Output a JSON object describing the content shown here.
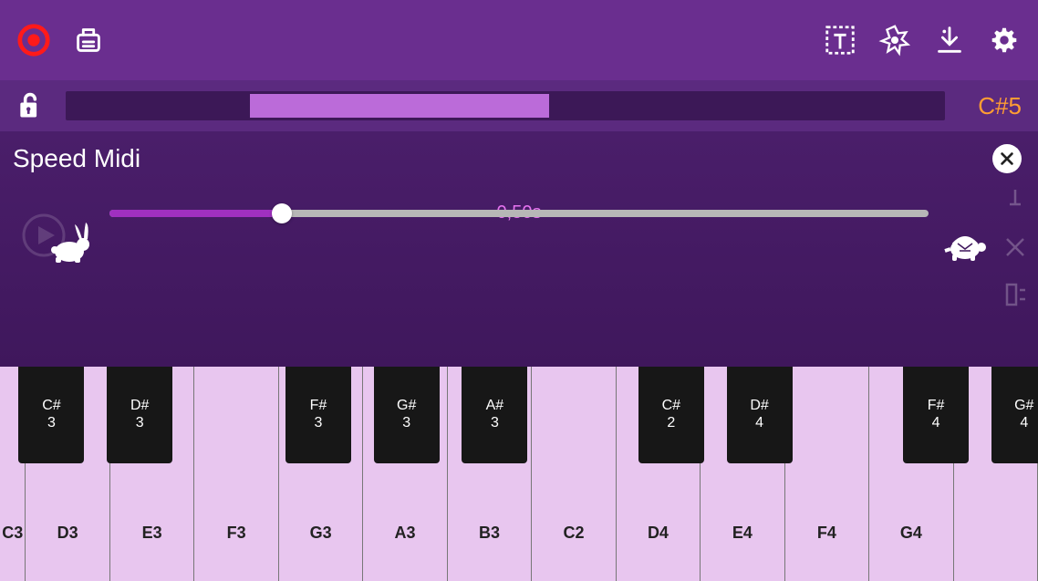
{
  "toolbar": {
    "icons": {
      "record": "record-icon",
      "midi_device": "midi-device-icon",
      "text_tool": "text-tool-icon",
      "effects": "effects-icon",
      "download": "download-icon",
      "settings": "settings-icon"
    }
  },
  "subbar": {
    "lock_icon": "unlock-icon",
    "note_label": "C#5",
    "range_fill_percent": 34
  },
  "dialog": {
    "title": "Speed Midi",
    "value_text": "0,50s",
    "slider_percent": 21,
    "fast_icon": "rabbit-icon",
    "slow_icon": "turtle-icon",
    "close_icon": "close-icon"
  },
  "side_controls": {
    "marker_icon": "marker-icon",
    "mute_icon": "mute-icon",
    "split_icon": "split-icon",
    "play_icon": "play-icon"
  },
  "piano": {
    "white_keys": [
      "C3",
      "D3",
      "E3",
      "F3",
      "G3",
      "A3",
      "B3",
      "C2",
      "D4",
      "E4",
      "F4",
      "G4",
      ""
    ],
    "black_keys": [
      {
        "note": "C#",
        "oct": "3",
        "pos": 1.8
      },
      {
        "note": "D#",
        "oct": "3",
        "pos": 10.3
      },
      {
        "note": "F#",
        "oct": "3",
        "pos": 27.5
      },
      {
        "note": "G#",
        "oct": "3",
        "pos": 36.0
      },
      {
        "note": "A#",
        "oct": "3",
        "pos": 44.5
      },
      {
        "note": "C#",
        "oct": "2",
        "pos": 61.5
      },
      {
        "note": "D#",
        "oct": "4",
        "pos": 70.0
      },
      {
        "note": "F#",
        "oct": "4",
        "pos": 87.0
      },
      {
        "note": "G#",
        "oct": "4",
        "pos": 95.5
      }
    ]
  }
}
